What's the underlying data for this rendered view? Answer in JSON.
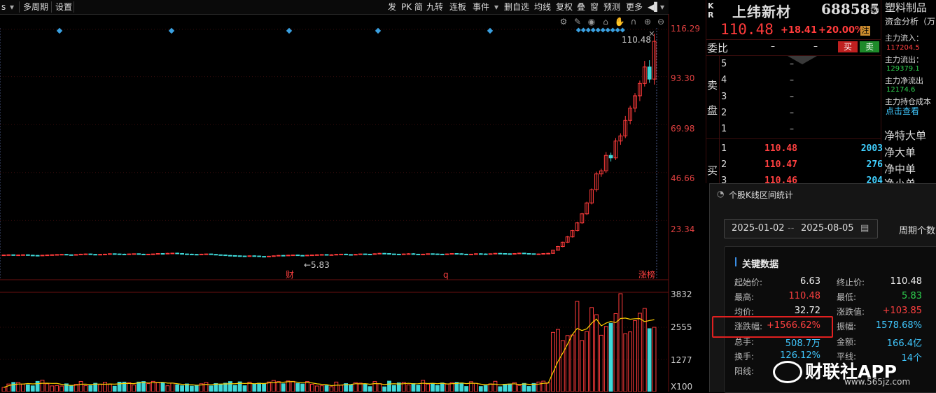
{
  "toolbar": {
    "left": [
      "s",
      "多周期",
      "设置"
    ],
    "right": [
      "发",
      "PK",
      "简",
      "九转",
      "连板",
      "事件",
      "删自选",
      "均线",
      "复权",
      "叠",
      "窗",
      "预测",
      "更多"
    ]
  },
  "price_axis": [
    "116.29",
    "93.30",
    "69.98",
    "46.66",
    "23.34"
  ],
  "volume_axis": [
    "3832",
    "2555",
    "1277",
    "X100"
  ],
  "chart_labels": {
    "high_marker": "110.48",
    "low_marker": "←5.83",
    "event_cai": "财",
    "event_q": "q",
    "zhangbang": "涨榜"
  },
  "colors": {
    "up": "#ff3b3b",
    "down": "#3fd8d8",
    "ma": "#ffd000",
    "grid": "#3a0d0d"
  },
  "chart_data": {
    "type": "bar",
    "close_daily": [
      6.6,
      6.7,
      6.5,
      6.6,
      6.7,
      6.5,
      6.4,
      6.3,
      6.5,
      6.6,
      6.7,
      6.8,
      6.9,
      6.7,
      6.6,
      6.8,
      7.0,
      7.1,
      6.9,
      6.8,
      6.9,
      7.0,
      7.2,
      7.1,
      7.0,
      6.9,
      7.1,
      7.2,
      7.0,
      6.9,
      7.0,
      7.1,
      7.3,
      7.2,
      7.4,
      7.5,
      7.3,
      7.1,
      7.0,
      6.9,
      6.8,
      7.0,
      7.1,
      6.9,
      6.7,
      6.6,
      6.4,
      6.3,
      6.2,
      6.1,
      6.0,
      6.2,
      6.1,
      5.9,
      5.83,
      6.0,
      6.2,
      6.4,
      6.3,
      6.5,
      6.6,
      6.4,
      6.3,
      6.5,
      6.6,
      6.7,
      6.8,
      6.6,
      6.7,
      6.9,
      7.0,
      6.8,
      6.7,
      6.9,
      7.1,
      7.0,
      6.9,
      7.2,
      7.4,
      7.3,
      7.1,
      7.0,
      6.9,
      7.1,
      7.2,
      7.0,
      6.8,
      7.0,
      7.2,
      7.1,
      7.0,
      6.9,
      7.1,
      7.3,
      7.2,
      7.0,
      6.9,
      7.0,
      7.2,
      7.1,
      7.0,
      7.2,
      7.4,
      7.3,
      7.2,
      7.1,
      7.3,
      7.5,
      7.3,
      7.2,
      7.0,
      7.1,
      7.3,
      7.4,
      8.9,
      10.7,
      12.8,
      15.4,
      18.5,
      22.2,
      26.6,
      31.9,
      38.3,
      46.0,
      47.5,
      55.0,
      53.8,
      62.0,
      64.5,
      72.0,
      78.0,
      84.0,
      90.0,
      98.0,
      92.1,
      110.48
    ],
    "volume_axis_max": 3832
  },
  "quote": {
    "kr": [
      "K",
      "R"
    ],
    "name": "上纬新材",
    "code": "688585",
    "price": "110.48",
    "change": "+18.41",
    "change_pct": "+20.00%",
    "zhu": "注",
    "weibi": "委比",
    "weibi_dash1": "–",
    "weibi_dash2": "–",
    "buy_btn": "买",
    "sell_btn": "卖",
    "sell_side_1": "卖",
    "sell_side_2": "盘",
    "buy_side": "买",
    "sell_levels": [
      "5",
      "4",
      "3",
      "2",
      "1"
    ],
    "buy_levels": [
      {
        "lvl": "1",
        "price": "110.48",
        "vol": "2003"
      },
      {
        "lvl": "2",
        "price": "110.47",
        "vol": "276"
      },
      {
        "lvl": "3",
        "price": "110.46",
        "vol": "204"
      }
    ]
  },
  "side_column": {
    "sector": "塑料制品",
    "capital": "资金分析（万",
    "inflow_label": "主力流入：",
    "inflow_val": "117204.5",
    "outflow_label": "主力流出：",
    "outflow_val": "129379.1",
    "net_label": "主力净流出",
    "net_val": "12174.6",
    "cost_label": "主力持仓成本",
    "link": "点击查看",
    "big1": "净特大单",
    "big2": "净大单",
    "big3": "净中单",
    "big4": "净小单"
  },
  "popup": {
    "title": "个股K线区间统计",
    "date_start": "2025-01-02",
    "date_sep": "--",
    "date_end": "2025-08-05",
    "period": "周期个数",
    "card_title": "关键数据",
    "rows": [
      {
        "l1": "起始价:",
        "v1": "6.63",
        "c1": "white",
        "l2": "终止价:",
        "v2": "110.48",
        "c2": "white"
      },
      {
        "l1": "最高:",
        "v1": "110.48",
        "c1": "red",
        "l2": "最低:",
        "v2": "5.83",
        "c2": "green"
      },
      {
        "l1": "均价:",
        "v1": "32.72",
        "c1": "white",
        "l2": "涨跌值:",
        "v2": "+103.85",
        "c2": "red"
      },
      {
        "l1": "涨跌幅:",
        "v1": "+1566.62%",
        "c1": "red",
        "l2": "振幅:",
        "v2": "1578.68%",
        "c2": "cyan"
      },
      {
        "l1": "总手:",
        "v1": "508.7万",
        "c1": "cyan",
        "l2": "金额:",
        "v2": "166.4亿",
        "c2": "cyan"
      },
      {
        "l1": "换手:",
        "v1": "126.12%",
        "c1": "cyan",
        "l2": "平线:",
        "v2": "14个",
        "c2": "cyan"
      },
      {
        "l1": "阳线:",
        "v1": "",
        "c1": "red",
        "l2": "",
        "v2": "",
        "c2": "white"
      }
    ]
  },
  "watermark": {
    "text": "财联社APP",
    "url": "www.565jz.com"
  }
}
